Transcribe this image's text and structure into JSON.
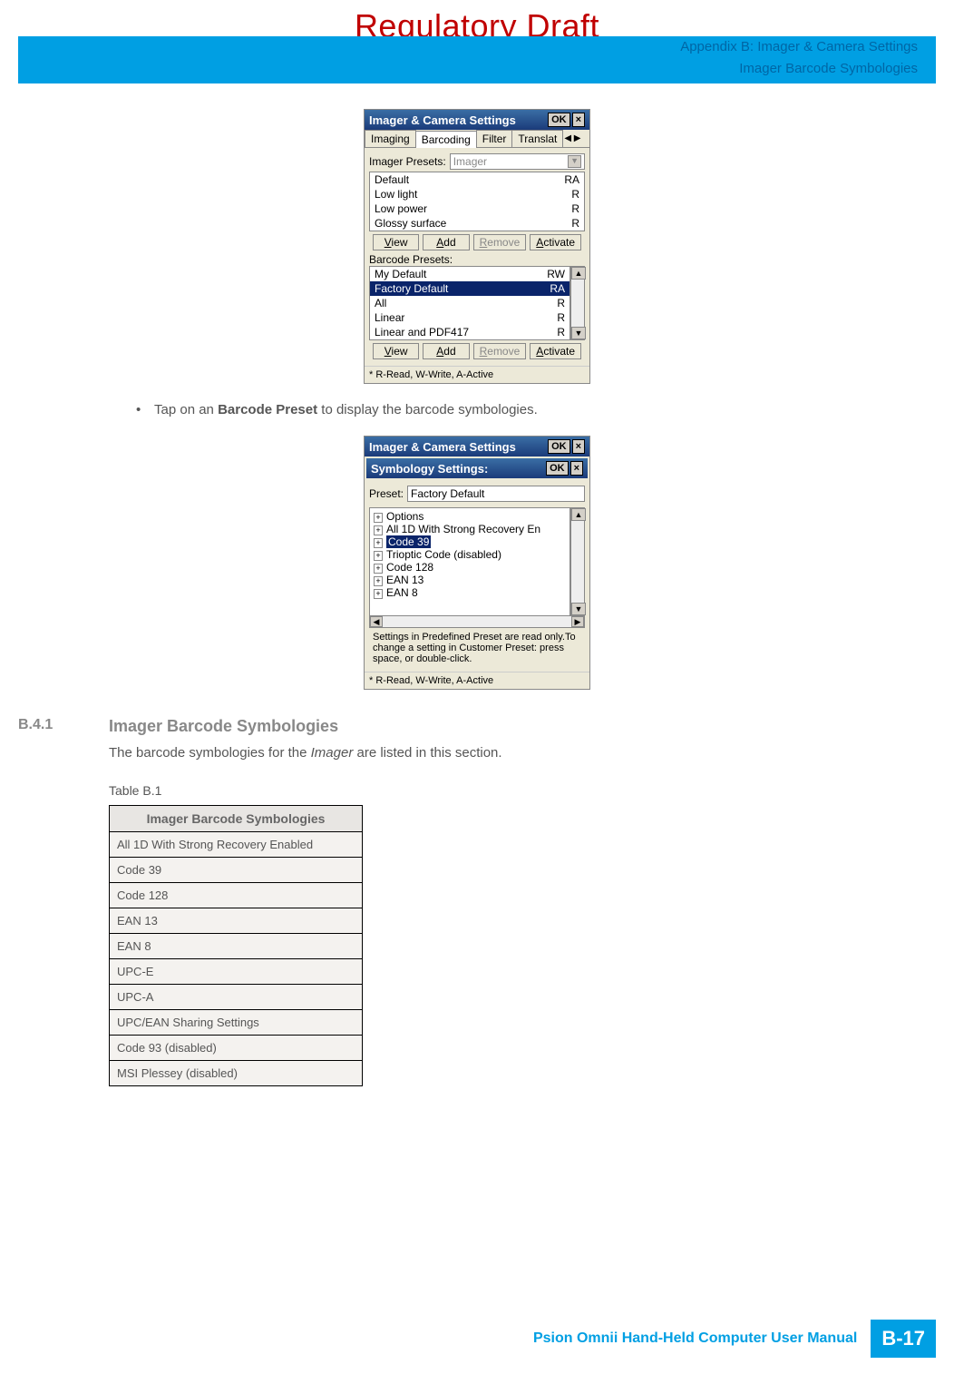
{
  "watermark": "Regulatory Draft",
  "header": {
    "line1": "Appendix B: Imager & Camera Settings",
    "line2": "Imager Barcode Symbologies"
  },
  "screenshot1": {
    "title": "Imager & Camera Settings",
    "ok": "OK",
    "close": "×",
    "tabs": {
      "imaging": "Imaging",
      "barcoding": "Barcoding",
      "filter": "Filter",
      "translat": "Translat"
    },
    "imager_presets_label": "Imager Presets:",
    "imager_presets_value": "Imager",
    "imager_list": [
      {
        "name": "Default",
        "attrs": "RA"
      },
      {
        "name": "Low light",
        "attrs": "R"
      },
      {
        "name": "Low power",
        "attrs": "R"
      },
      {
        "name": "Glossy surface",
        "attrs": "R"
      }
    ],
    "buttons": {
      "view": "View",
      "add": "Add",
      "remove": "Remove",
      "activate": "Activate"
    },
    "barcode_presets_label": "Barcode Presets:",
    "barcode_list": [
      {
        "name": "My Default",
        "attrs": "RW"
      },
      {
        "name": "Factory Default",
        "attrs": "RA",
        "selected": true
      },
      {
        "name": "All",
        "attrs": "R"
      },
      {
        "name": "Linear",
        "attrs": "R"
      },
      {
        "name": "Linear and PDF417",
        "attrs": "R"
      }
    ],
    "footer_note": "* R-Read, W-Write, A-Active"
  },
  "bullet_text_prefix": "Tap on an ",
  "bullet_text_bold": "Barcode Preset",
  "bullet_text_suffix": " to display the barcode symbologies.",
  "screenshot2": {
    "title": "Imager & Camera Settings",
    "ok": "OK",
    "close": "×",
    "sub_title": "Symbology Settings:",
    "sub_ok": "OK",
    "sub_close": "×",
    "preset_label": "Preset:",
    "preset_value": "Factory Default",
    "tree": [
      "Options",
      "All 1D With Strong Recovery En",
      "Code 39",
      "Trioptic Code (disabled)",
      "Code 128",
      "EAN 13",
      "EAN 8"
    ],
    "tree_selected_index": 2,
    "note": "Settings in Predefined Preset are read only.To change a setting in Customer Preset: press space, or double-click.",
    "footer_note": "* R-Read, W-Write, A-Active"
  },
  "section": {
    "number": "B.4.1",
    "title": "Imager Barcode Symbologies",
    "body_prefix": "The barcode symbologies for the ",
    "body_italic": "Imager",
    "body_suffix": " are listed in this section."
  },
  "table": {
    "caption": "Table B.1",
    "header": "Imager Barcode Symbologies",
    "rows": [
      "All 1D With Strong Recovery Enabled",
      "Code 39",
      "Code 128",
      "EAN 13",
      "EAN 8",
      "UPC-E",
      "UPC-A",
      "UPC/EAN Sharing Settings",
      "Code 93 (disabled)",
      "MSI Plessey (disabled)"
    ]
  },
  "footer": {
    "text": "Psion Omnii Hand-Held Computer User Manual",
    "page": "B-17"
  }
}
